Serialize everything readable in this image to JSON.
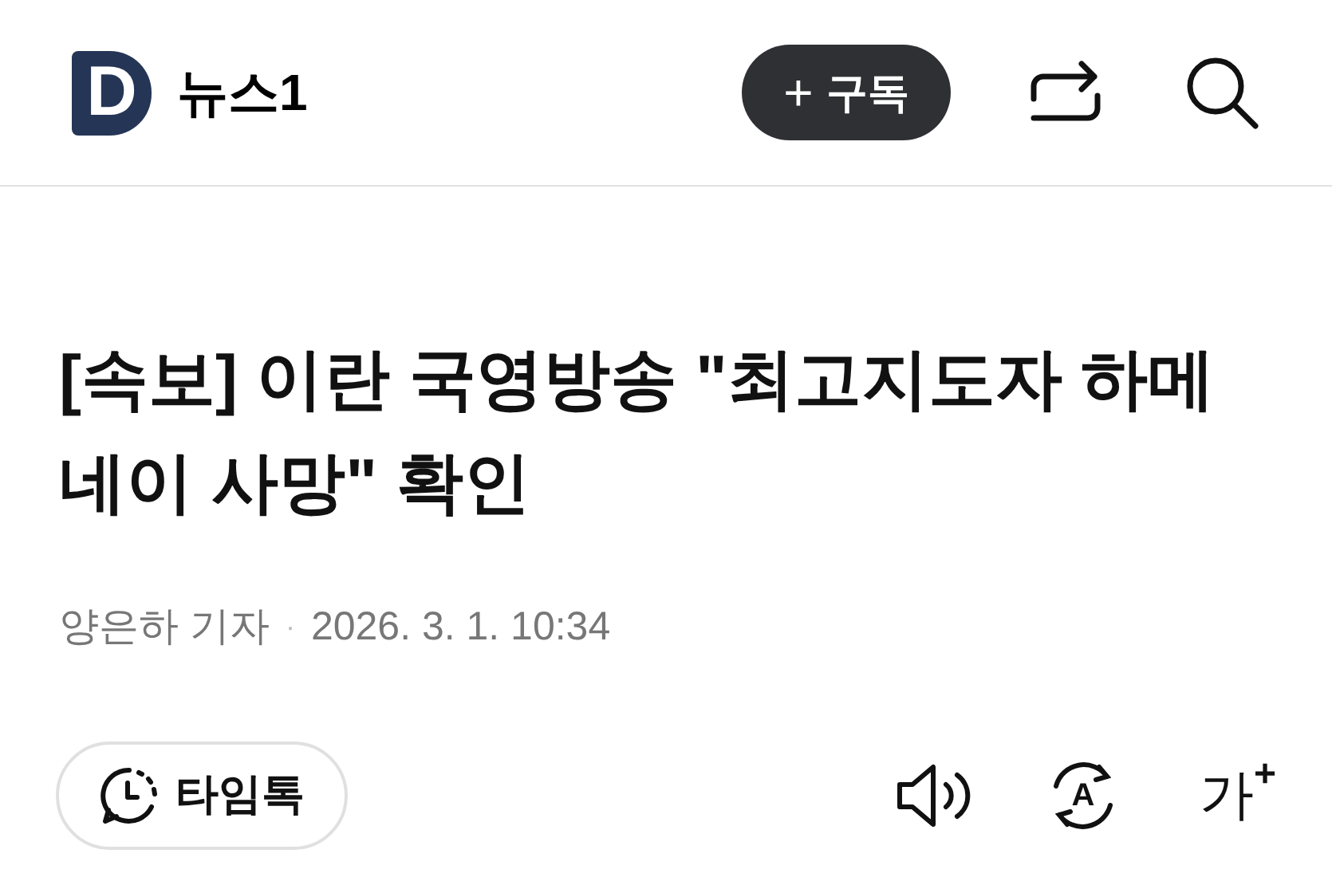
{
  "header": {
    "logo_letter": "D",
    "site_name": "뉴스1",
    "subscribe_button": {
      "icon": "+",
      "label": "구독"
    }
  },
  "article": {
    "headline": "[속보] 이란 국영방송 \"최고지도자 하메네이 사망\" 확인",
    "reporter": "양은하 기자",
    "separator": "·",
    "date": "2026. 3. 1. 10:34"
  },
  "toolbar": {
    "timetalk_button": "타임톡",
    "translate_label": "A",
    "font_size_label": "가",
    "font_size_plus": "+"
  }
}
